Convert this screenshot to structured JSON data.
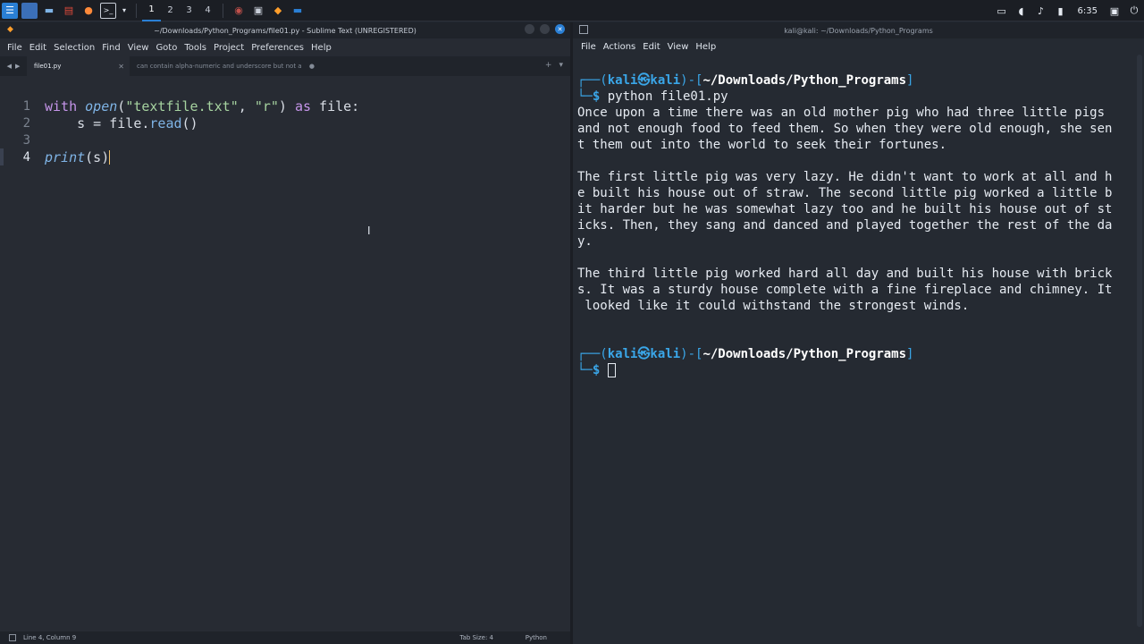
{
  "taskbar": {
    "workspaces": [
      "1",
      "2",
      "3",
      "4"
    ],
    "clock": "6:35"
  },
  "sublime": {
    "title": "~/Downloads/Python_Programs/file01.py - Sublime Text (UNREGISTERED)",
    "menu": [
      "File",
      "Edit",
      "Selection",
      "Find",
      "View",
      "Goto",
      "Tools",
      "Project",
      "Preferences",
      "Help"
    ],
    "tabs": [
      {
        "label": "file01.py",
        "active": true
      },
      {
        "label": "can contain alpha-numeric and underscore but not a",
        "active": false
      }
    ],
    "line_numbers": [
      "1",
      "2",
      "3",
      "4"
    ],
    "code": {
      "line1": {
        "kw_with": "with",
        "fn_open": "open",
        "p1": "(",
        "s1": "\"textfile.txt\"",
        "comma": ", ",
        "s2": "\"r\"",
        "p2": ") ",
        "kw_as": "as",
        "rest": " file:"
      },
      "line2": {
        "indent": "    s = file.",
        "meth": "read",
        "rest": "()"
      },
      "line4": {
        "fn_print": "print",
        "rest": "(s)"
      }
    },
    "status": {
      "position": "Line 4, Column 9",
      "tab_size": "Tab Size: 4",
      "syntax": "Python"
    }
  },
  "terminal": {
    "title": "kali@kali: ~/Downloads/Python_Programs",
    "menu": [
      "File",
      "Actions",
      "Edit",
      "View",
      "Help"
    ],
    "prompt_frame_top": "┌──(",
    "prompt_user": "kali㉿kali",
    "prompt_mid": ")-[",
    "prompt_path": "~/Downloads/Python_Programs",
    "prompt_end": "]",
    "prompt_frame_bottom": "└─",
    "prompt_dollar": "$ ",
    "command": "python file01.py",
    "output": [
      "Once upon a time there was an old mother pig who had three little pigs",
      "and not enough food to feed them. So when they were old enough, she sen",
      "t them out into the world to seek their fortunes.",
      "",
      "The first little pig was very lazy. He didn't want to work at all and h",
      "e built his house out of straw. The second little pig worked a little b",
      "it harder but he was somewhat lazy too and he built his house out of st",
      "icks. Then, they sang and danced and played together the rest of the da",
      "y.",
      "",
      "The third little pig worked hard all day and built his house with brick",
      "s. It was a sturdy house complete with a fine fireplace and chimney. It",
      " looked like it could withstand the strongest winds.",
      "",
      ""
    ]
  }
}
